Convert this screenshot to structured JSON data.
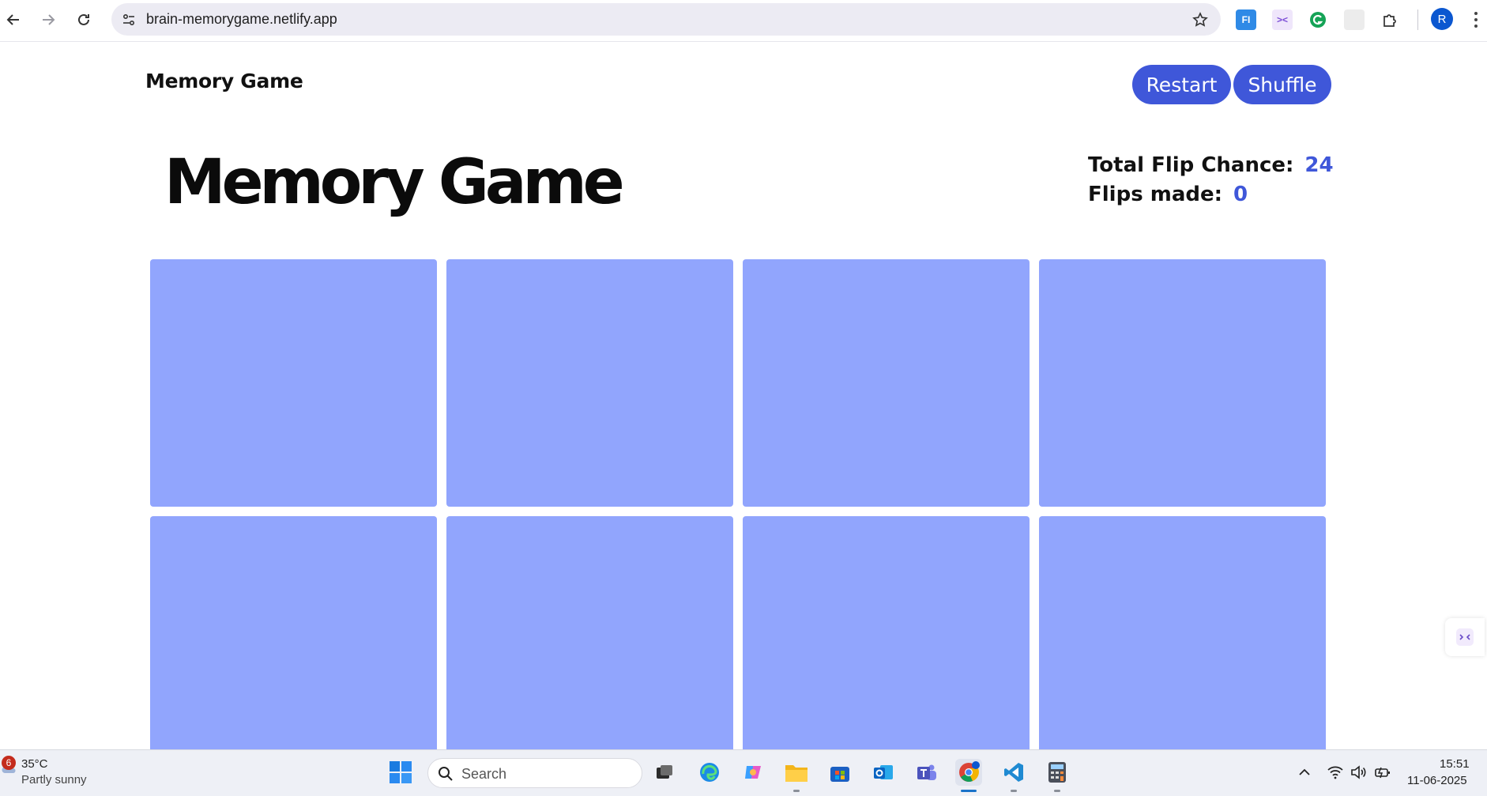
{
  "browser": {
    "url": "brain-memorygame.netlify.app",
    "profile_initial": "R",
    "extensions": [
      "fi-extension-icon",
      "monica-extension-icon",
      "grammarly-extension-icon",
      "blank-extension-icon",
      "puzzle-extensions-icon"
    ]
  },
  "page": {
    "brand": "Memory Game",
    "buttons": {
      "restart": "Restart",
      "shuffle": "Shuffle"
    },
    "heading": "Memory Game",
    "stats": {
      "total_flip_label": "Total Flip Chance:",
      "total_flip_value": "24",
      "flips_made_label": "Flips made:",
      "flips_made_value": "0"
    },
    "cards": [
      {
        "state": "face-down"
      },
      {
        "state": "face-down"
      },
      {
        "state": "face-down"
      },
      {
        "state": "face-down"
      },
      {
        "state": "face-down"
      },
      {
        "state": "face-down"
      },
      {
        "state": "face-down"
      },
      {
        "state": "face-down"
      }
    ],
    "colors": {
      "accent": "#3f57d9",
      "card": "#91a5fd"
    }
  },
  "taskbar": {
    "weather": {
      "badge": "6",
      "temp": "35°C",
      "desc": "Partly sunny"
    },
    "search_placeholder": "Search",
    "time": "15:51",
    "date": "11-06-2025"
  }
}
